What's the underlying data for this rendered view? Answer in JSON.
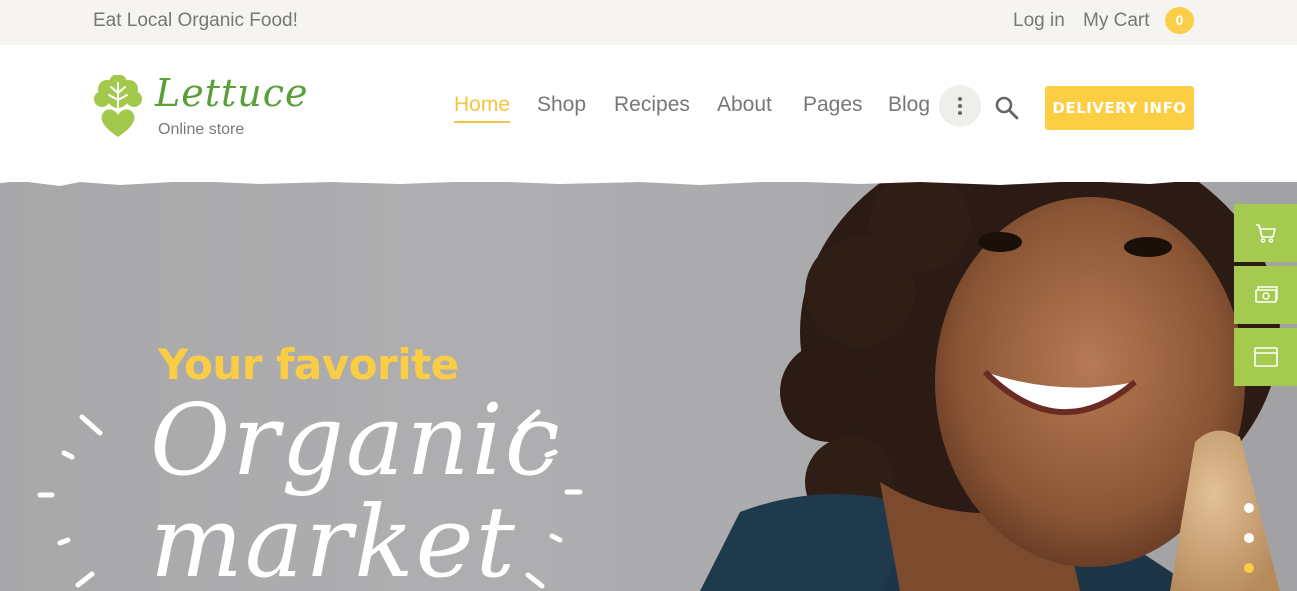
{
  "topbar": {
    "tagline": "Eat Local Organic Food!",
    "login": "Log in",
    "cart_label": "My Cart",
    "cart_count": "0"
  },
  "brand": {
    "name": "Lettuce",
    "subtitle": "Online store",
    "logo_icon": "lettuce-heart-icon"
  },
  "nav": {
    "items": [
      {
        "label": "Home",
        "active": true
      },
      {
        "label": "Shop"
      },
      {
        "label": "Recipes"
      },
      {
        "label": "About"
      },
      {
        "label": "Pages"
      },
      {
        "label": "Blog"
      }
    ],
    "more_icon": "vertical-dots-icon",
    "search_icon": "search-icon"
  },
  "cta": {
    "delivery": "DELIVERY INFO"
  },
  "hero": {
    "line1": "Your favorite",
    "line2": "Organic",
    "line3": "market",
    "active_slide": 3,
    "slide_count": 3
  },
  "side_widgets": [
    {
      "icon": "cart-icon"
    },
    {
      "icon": "money-icon"
    },
    {
      "icon": "browser-window-icon"
    }
  ],
  "colors": {
    "accent_yellow": "#fbcd44",
    "brand_green": "#5a9f3a",
    "side_green": "#a4cb4f",
    "topbar_bg": "#f5f4f1"
  }
}
